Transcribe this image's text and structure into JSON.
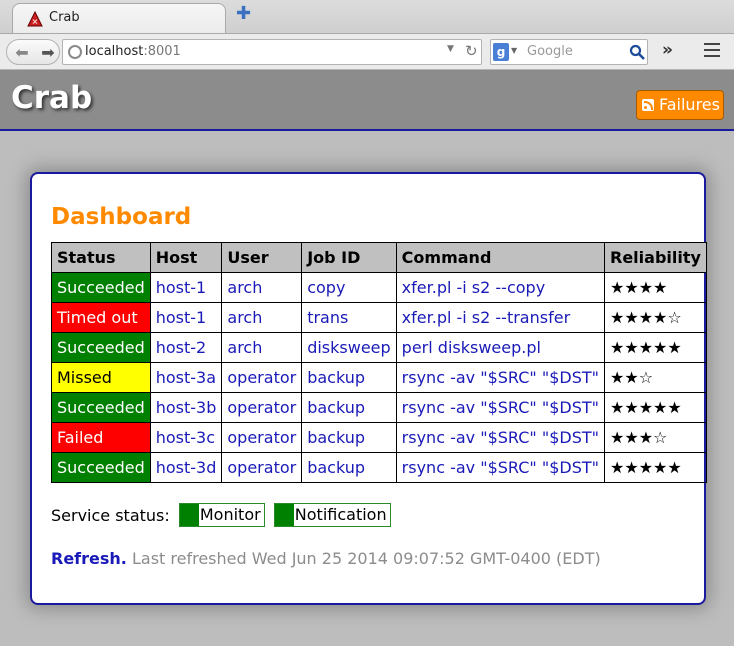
{
  "browser": {
    "tab_title": "Crab",
    "url_host": "localhost",
    "url_port": ":8001",
    "search_placeholder": "Google",
    "engine_letter": "g",
    "overflow": "»"
  },
  "header": {
    "title": "Crab",
    "failures_label": "Failures",
    "failures_color": "#ff8a00"
  },
  "dashboard": {
    "title": "Dashboard",
    "columns": [
      "Status",
      "Host",
      "User",
      "Job ID",
      "Command",
      "Reliability"
    ],
    "rows": [
      {
        "status": "Succeeded",
        "status_color": "#008000",
        "host": "host-1",
        "user": "arch",
        "job_id": "copy",
        "command": "xfer.pl -i s2 --copy",
        "reliability": "★★★★"
      },
      {
        "status": "Timed out",
        "status_color": "#ff0000",
        "host": "host-1",
        "user": "arch",
        "job_id": "trans",
        "command": "xfer.pl -i s2 --transfer",
        "reliability": "★★★★☆"
      },
      {
        "status": "Succeeded",
        "status_color": "#008000",
        "host": "host-2",
        "user": "arch",
        "job_id": "disksweep",
        "command": "perl disksweep.pl",
        "reliability": "★★★★★"
      },
      {
        "status": "Missed",
        "status_color": "#ffff00",
        "host": "host-3a",
        "user": "operator",
        "job_id": "backup",
        "command": "rsync -av \"$SRC\" \"$DST\"",
        "reliability": "★★☆"
      },
      {
        "status": "Succeeded",
        "status_color": "#008000",
        "host": "host-3b",
        "user": "operator",
        "job_id": "backup",
        "command": "rsync -av \"$SRC\" \"$DST\"",
        "reliability": "★★★★★"
      },
      {
        "status": "Failed",
        "status_color": "#ff0000",
        "host": "host-3c",
        "user": "operator",
        "job_id": "backup",
        "command": "rsync -av \"$SRC\" \"$DST\"",
        "reliability": "★★★☆"
      },
      {
        "status": "Succeeded",
        "status_color": "#008000",
        "host": "host-3d",
        "user": "operator",
        "job_id": "backup",
        "command": "rsync -av \"$SRC\" \"$DST\"",
        "reliability": "★★★★★"
      }
    ]
  },
  "service_status": {
    "label": "Service status:",
    "monitor": "Monitor",
    "notification": "Notification",
    "ok_color": "#008000"
  },
  "refresh": {
    "link": "Refresh.",
    "text": "Last refreshed Wed Jun 25 2014 09:07:52 GMT-0400 (EDT)"
  }
}
